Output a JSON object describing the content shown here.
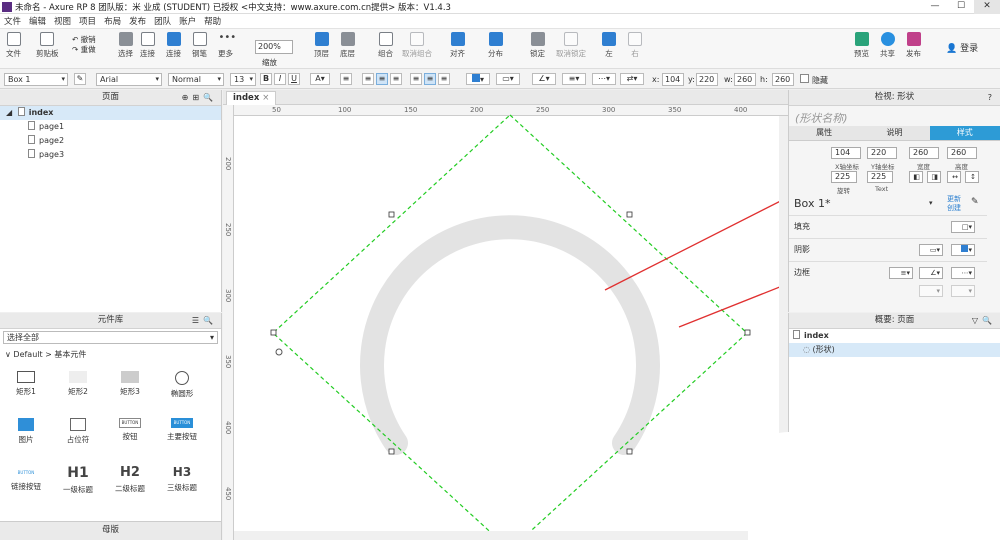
{
  "window": {
    "title": "未命名 - Axure RP 8 团队版：米 业成 (STUDENT) 已授权    <中文支持：www.axure.com.cn提供> 版本：V1.4.3",
    "controls": [
      "—",
      "☐",
      "✕"
    ]
  },
  "menu": [
    "文件",
    "编辑",
    "视图",
    "项目",
    "布局",
    "发布",
    "团队",
    "账户",
    "帮助"
  ],
  "toolbar": {
    "file": "文件",
    "clipboard": "剪贴板",
    "undo": "撤销",
    "redo": "重做",
    "select": "选择",
    "connect": "连接",
    "pen": "钢笔",
    "more": "更多",
    "zoom_value": "200%",
    "zoom_label": "缩放",
    "top": "顶层",
    "bottom": "底层",
    "group": "组合",
    "ungroup": "取消组合",
    "align": "对齐",
    "distribute": "分布",
    "lock": "锁定",
    "unlock": "取消锁定",
    "left": "左",
    "right": "右",
    "preview": "预览",
    "share": "共享",
    "publish": "发布",
    "login": "登录"
  },
  "format": {
    "widget_name": "Box 1",
    "font": "Arial",
    "weight": "Normal",
    "size": "13",
    "x_label": "x:",
    "x": "104",
    "y_label": "y:",
    "y": "220",
    "w_label": "w:",
    "w": "260",
    "h_label": "h:",
    "h": "260",
    "hide": "隐藏",
    "bold": "B",
    "italic": "I",
    "underline": "U"
  },
  "pages_panel": {
    "title": "页面",
    "root": "index",
    "children": [
      "page1",
      "page2",
      "page3"
    ]
  },
  "library": {
    "title": "元件库",
    "select": "选择全部",
    "category": "Default > 基本元件",
    "widgets": [
      "矩形1",
      "矩形2",
      "矩形3",
      "椭圆形",
      "图片",
      "占位符",
      "按钮",
      "主要按钮",
      "链接按钮",
      "一级标题",
      "二级标题",
      "三级标题"
    ],
    "button_text": "BUTTON",
    "h1": "H1",
    "h2": "H2",
    "h3": "H3"
  },
  "masters_panel": {
    "title": "母版"
  },
  "canvas": {
    "tab": "index",
    "ruler_h": [
      "50",
      "100",
      "150",
      "200",
      "250",
      "300",
      "350",
      "400"
    ],
    "ruler_v": [
      "200",
      "250",
      "300",
      "350",
      "400",
      "450"
    ],
    "arc_color": "#e3e3e3",
    "selection_color": "#22cc22",
    "arrow_color": "#e03030"
  },
  "inspector": {
    "title": "检视: 形状",
    "shape_name_placeholder": "(形状名称)",
    "tabs": [
      "属性",
      "说明",
      "样式"
    ],
    "x": "104",
    "y": "220",
    "w": "260",
    "h": "260",
    "x_label": "X轴坐标",
    "y_label": "Y轴坐标",
    "w_label": "宽度",
    "h_label": "高度",
    "rotate": "225",
    "text_rotate": "225",
    "rotate_label": "旋转",
    "text_label": "Text",
    "style_name": "Box 1*",
    "update": "更新",
    "create": "创建",
    "fill": "填充",
    "shadow": "阴影",
    "border": "边框"
  },
  "outline": {
    "title": "概要: 页面",
    "root": "index",
    "item": "(形状)"
  }
}
